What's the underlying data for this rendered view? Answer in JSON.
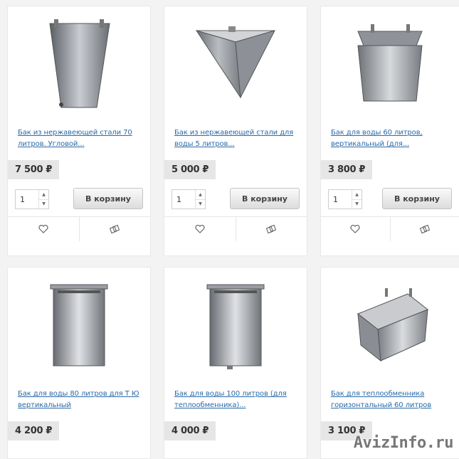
{
  "products": [
    {
      "title": "Бак из нержавеющей стали 70 литров. Угловой...",
      "price": "7 500 ₽",
      "qty": "1",
      "cart_label": "В корзину"
    },
    {
      "title": "Бак из нержавеющей стали для воды 5 литров...",
      "price": "5 000 ₽",
      "qty": "1",
      "cart_label": "В корзину"
    },
    {
      "title": "Бак для воды 60 литров, вертикальный (для...",
      "price": "3 800 ₽",
      "qty": "1",
      "cart_label": "В корзину"
    },
    {
      "title": "Бак для воды 80 литров для Т Ю вертикальный",
      "price": "4 200 ₽"
    },
    {
      "title": "Бак для воды 100 литров (для теплообменника)...",
      "price": "4 000 ₽"
    },
    {
      "title": "Бак для теплообменника горизонтальный 60 литров",
      "price": "3 100 ₽"
    }
  ],
  "icons": {
    "wishlist": "heart-icon",
    "compare": "compare-icon"
  },
  "watermark": "AvizInfo.ru",
  "colors": {
    "link": "#2b6aa8",
    "price_bg": "#e6e6e6",
    "card_bg": "#ffffff",
    "page_bg": "#f3f3f3"
  }
}
